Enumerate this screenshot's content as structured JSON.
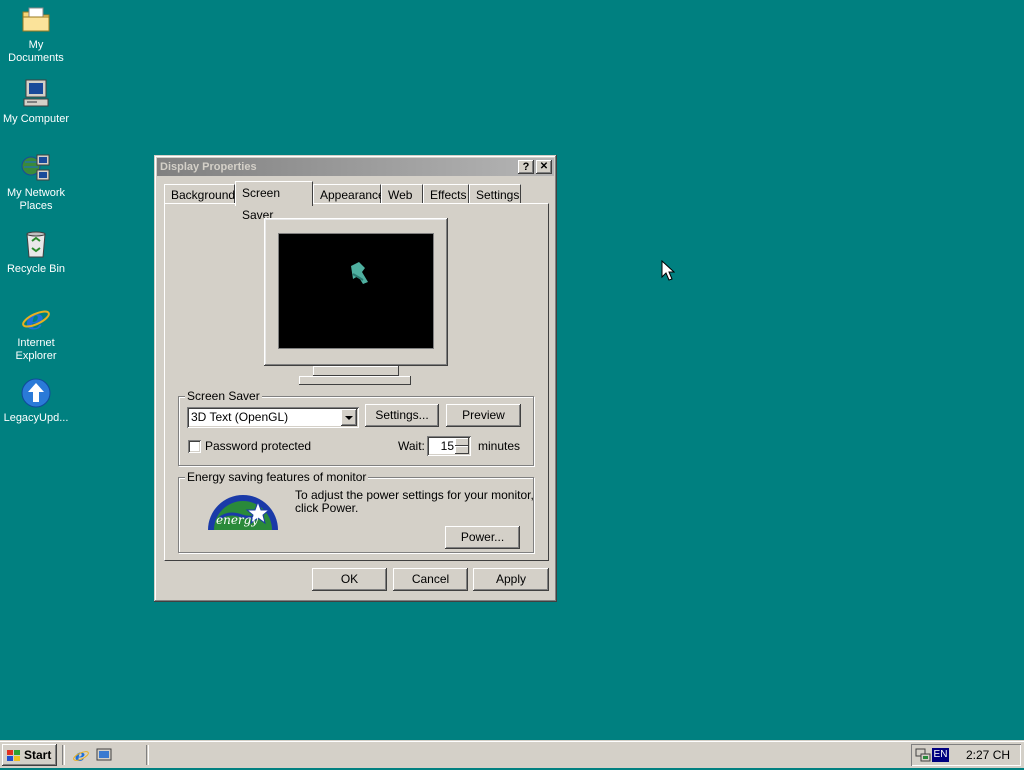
{
  "desktop": {
    "icons": [
      {
        "label": "My Documents",
        "icon": "folder-icon"
      },
      {
        "label": "My Computer",
        "icon": "computer-icon"
      },
      {
        "label_line1": "My Network",
        "label_line2": "Places",
        "icon": "network-places-icon"
      },
      {
        "label": "Recycle Bin",
        "icon": "recycle-bin-icon"
      },
      {
        "label_line1": "Internet",
        "label_line2": "Explorer",
        "icon": "internet-explorer-icon"
      },
      {
        "label": "LegacyUpd...",
        "icon": "legacy-update-icon"
      }
    ],
    "background_color": "#008080"
  },
  "window": {
    "title": "Display Properties",
    "help_button": "?",
    "close_button": "✕",
    "tabs": [
      {
        "label": "Background"
      },
      {
        "label": "Screen Saver",
        "active": true
      },
      {
        "label": "Appearance"
      },
      {
        "label": "Web"
      },
      {
        "label": "Effects"
      },
      {
        "label": "Settings"
      }
    ],
    "screen_saver": {
      "group_title": "Screen Saver",
      "selected": "3D Text (OpenGL)",
      "settings_button": "Settings...",
      "preview_button": "Preview",
      "password_label": "Password protected",
      "password_checked": false,
      "wait_label": "Wait:",
      "wait_value": "15",
      "wait_unit": "minutes"
    },
    "energy": {
      "group_title": "Energy saving features of monitor",
      "line1": "To adjust the power settings for your monitor,",
      "line2": "click Power.",
      "power_button": "Power...",
      "logo_text": "energy"
    },
    "buttons": {
      "ok": "OK",
      "cancel": "Cancel",
      "apply": "Apply"
    }
  },
  "taskbar": {
    "start_label": "Start",
    "language": "EN",
    "clock": "2:27 CH"
  }
}
